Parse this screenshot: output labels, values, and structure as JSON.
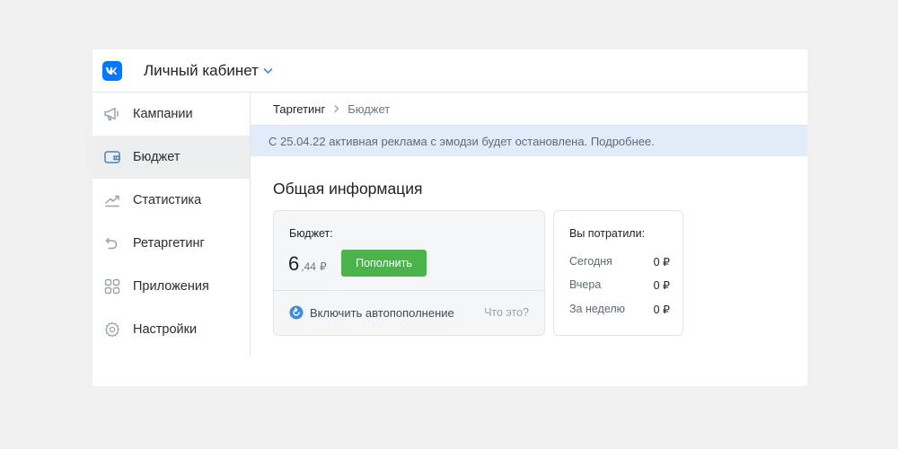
{
  "header": {
    "title": "Личный кабинет",
    "logo_icon": "vk-logo-icon",
    "brand_color": "#0077ff"
  },
  "sidebar": {
    "items": [
      {
        "label": "Кампании",
        "icon": "megaphone-icon",
        "active": false
      },
      {
        "label": "Бюджет",
        "icon": "wallet-icon",
        "active": true
      },
      {
        "label": "Статистика",
        "icon": "chart-line-icon",
        "active": false
      },
      {
        "label": "Ретаргетинг",
        "icon": "undo-arrow-icon",
        "active": false
      },
      {
        "label": "Приложения",
        "icon": "apps-grid-icon",
        "active": false
      },
      {
        "label": "Настройки",
        "icon": "gear-icon",
        "active": false
      }
    ]
  },
  "breadcrumb": {
    "parent": "Таргетинг",
    "current": "Бюджет"
  },
  "notice": {
    "text": "С 25.04.22 активная реклама с эмодзи будет остановлена.",
    "link": "Подробнее."
  },
  "main": {
    "section_title": "Общая информация"
  },
  "budget": {
    "label": "Бюджет:",
    "amount_integer": "6",
    "amount_decimal": ",44",
    "currency": "₽",
    "topup_label": "Пополнить",
    "autofill_label": "Включить автопополнение",
    "help_link": "Что это?",
    "button_color": "#4bb34b"
  },
  "spent": {
    "title": "Вы потратили:",
    "rows": [
      {
        "label": "Сегодня",
        "value": "0 ₽"
      },
      {
        "label": "Вчера",
        "value": "0 ₽"
      },
      {
        "label": "За неделю",
        "value": "0 ₽"
      }
    ]
  }
}
